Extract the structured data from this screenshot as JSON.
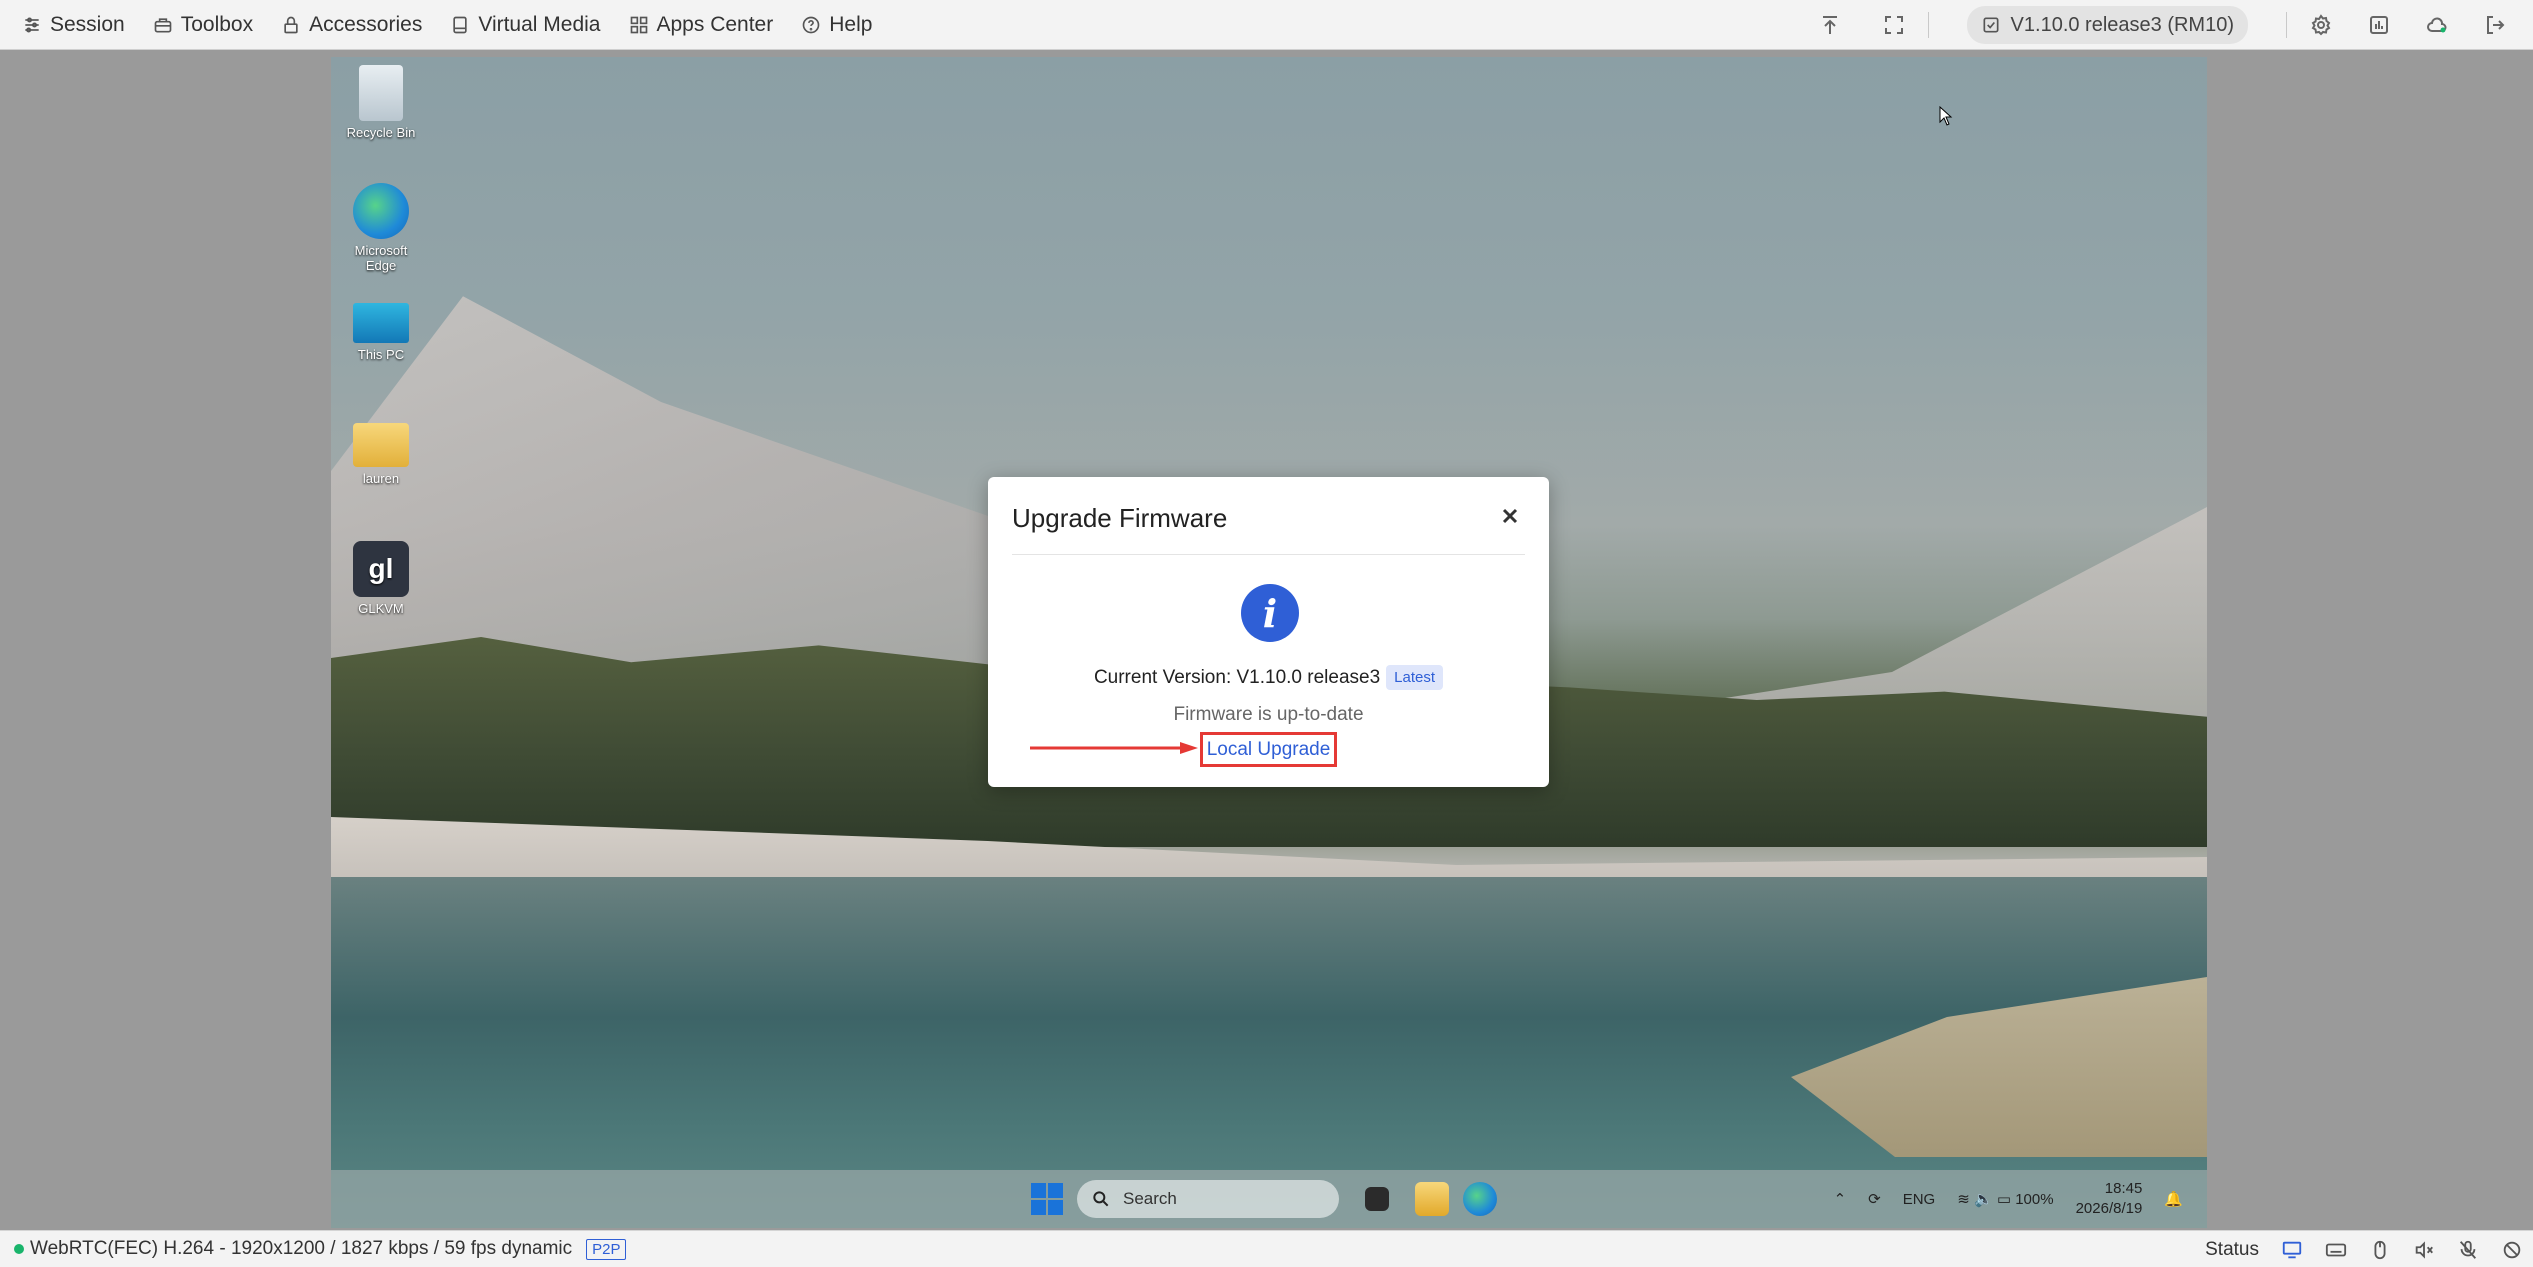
{
  "toolbar": {
    "menu": [
      {
        "label": "Session",
        "icon": "sliders-icon"
      },
      {
        "label": "Toolbox",
        "icon": "toolbox-icon"
      },
      {
        "label": "Accessories",
        "icon": "lock-icon"
      },
      {
        "label": "Virtual Media",
        "icon": "disk-icon"
      },
      {
        "label": "Apps Center",
        "icon": "apps-icon"
      },
      {
        "label": "Help",
        "icon": "help-icon"
      }
    ],
    "version_label": "V1.10.0 release3 (RM10)"
  },
  "desktop": {
    "icons": [
      {
        "label": "Recycle Bin"
      },
      {
        "label": "Microsoft Edge"
      },
      {
        "label": "This PC"
      },
      {
        "label": "lauren"
      },
      {
        "label": "GLKVM"
      }
    ],
    "taskbar": {
      "search_placeholder": "Search",
      "lang": "ENG",
      "battery": "100%",
      "time": "18:45",
      "date": "2026/8/19"
    }
  },
  "modal": {
    "title": "Upgrade Firmware",
    "current_version_label": "Current Version: V1.10.0 release3",
    "latest_badge": "Latest",
    "status": "Firmware is up-to-date",
    "local_upgrade": "Local Upgrade"
  },
  "statusbar": {
    "stream_info": "WebRTC(FEC) H.264 - 1920x1200  /  1827 kbps / 59 fps dynamic",
    "p2p": "P2P",
    "status_label": "Status"
  },
  "colors": {
    "accent": "#2f5fd6",
    "highlight": "#e53935",
    "online": "#19b46b"
  }
}
